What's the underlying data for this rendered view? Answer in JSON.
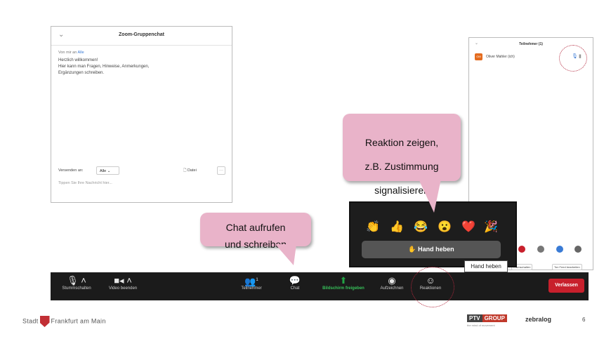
{
  "chat": {
    "title": "Zoom-Gruppenchat",
    "from_prefix": "Von mir an",
    "from_target": "Alle",
    "message_line1": "Herzlich willkommen!",
    "message_line2": "Hier kann man Fragen, Hinweise, Anmerkungen,",
    "message_line3": "Ergänzungen schreiben.",
    "send_to_label": "Versenden an:",
    "send_to_value": "Alle",
    "file_label": "Datei",
    "more_label": "···",
    "input_placeholder": "Tippen Sie Ihre Nachricht hier..."
  },
  "participants": {
    "title": "Teilnehmer (1)",
    "row_name": "Oliver Mahler (ich)",
    "row_initials": "OM",
    "btn_left": "…umschalten",
    "btn_right": "Ton Feed bearbeiten"
  },
  "callouts": {
    "reaction_line1": "Reaktion zeigen,",
    "reaction_line2": "z.B. Zustimmung",
    "reaction_line3": "signalisieren",
    "chat_line1": "Chat aufrufen",
    "chat_line2": "und schreiben"
  },
  "reactions": {
    "emojis": [
      "👏",
      "👍",
      "😂",
      "😮",
      "❤️",
      "🎉"
    ],
    "hand_button": "Hand heben",
    "tooltip": "Hand heben"
  },
  "toolbar": {
    "mute": "Stummschalten",
    "video": "Video beenden",
    "participants": "Teilnehmer",
    "participants_count": "1",
    "chat": "Chat",
    "share": "Bildschirm freigeben",
    "record": "Aufzeichnen",
    "reactions": "Reaktionen",
    "leave": "Verlassen"
  },
  "footer": {
    "city_left": "Stadt",
    "city_right": "Frankfurt am Main",
    "ptv_a": "PTV",
    "ptv_b": "GROUP",
    "ptv_sub": "the mind of movement",
    "zebralog": "zebralog",
    "page": "6"
  },
  "colors": {
    "callout": "#e9b3c9",
    "toolbar": "#1b1b1b",
    "share_green": "#37c15a",
    "leave_red": "#c8202c",
    "highlight_circle": "#b3283e"
  }
}
